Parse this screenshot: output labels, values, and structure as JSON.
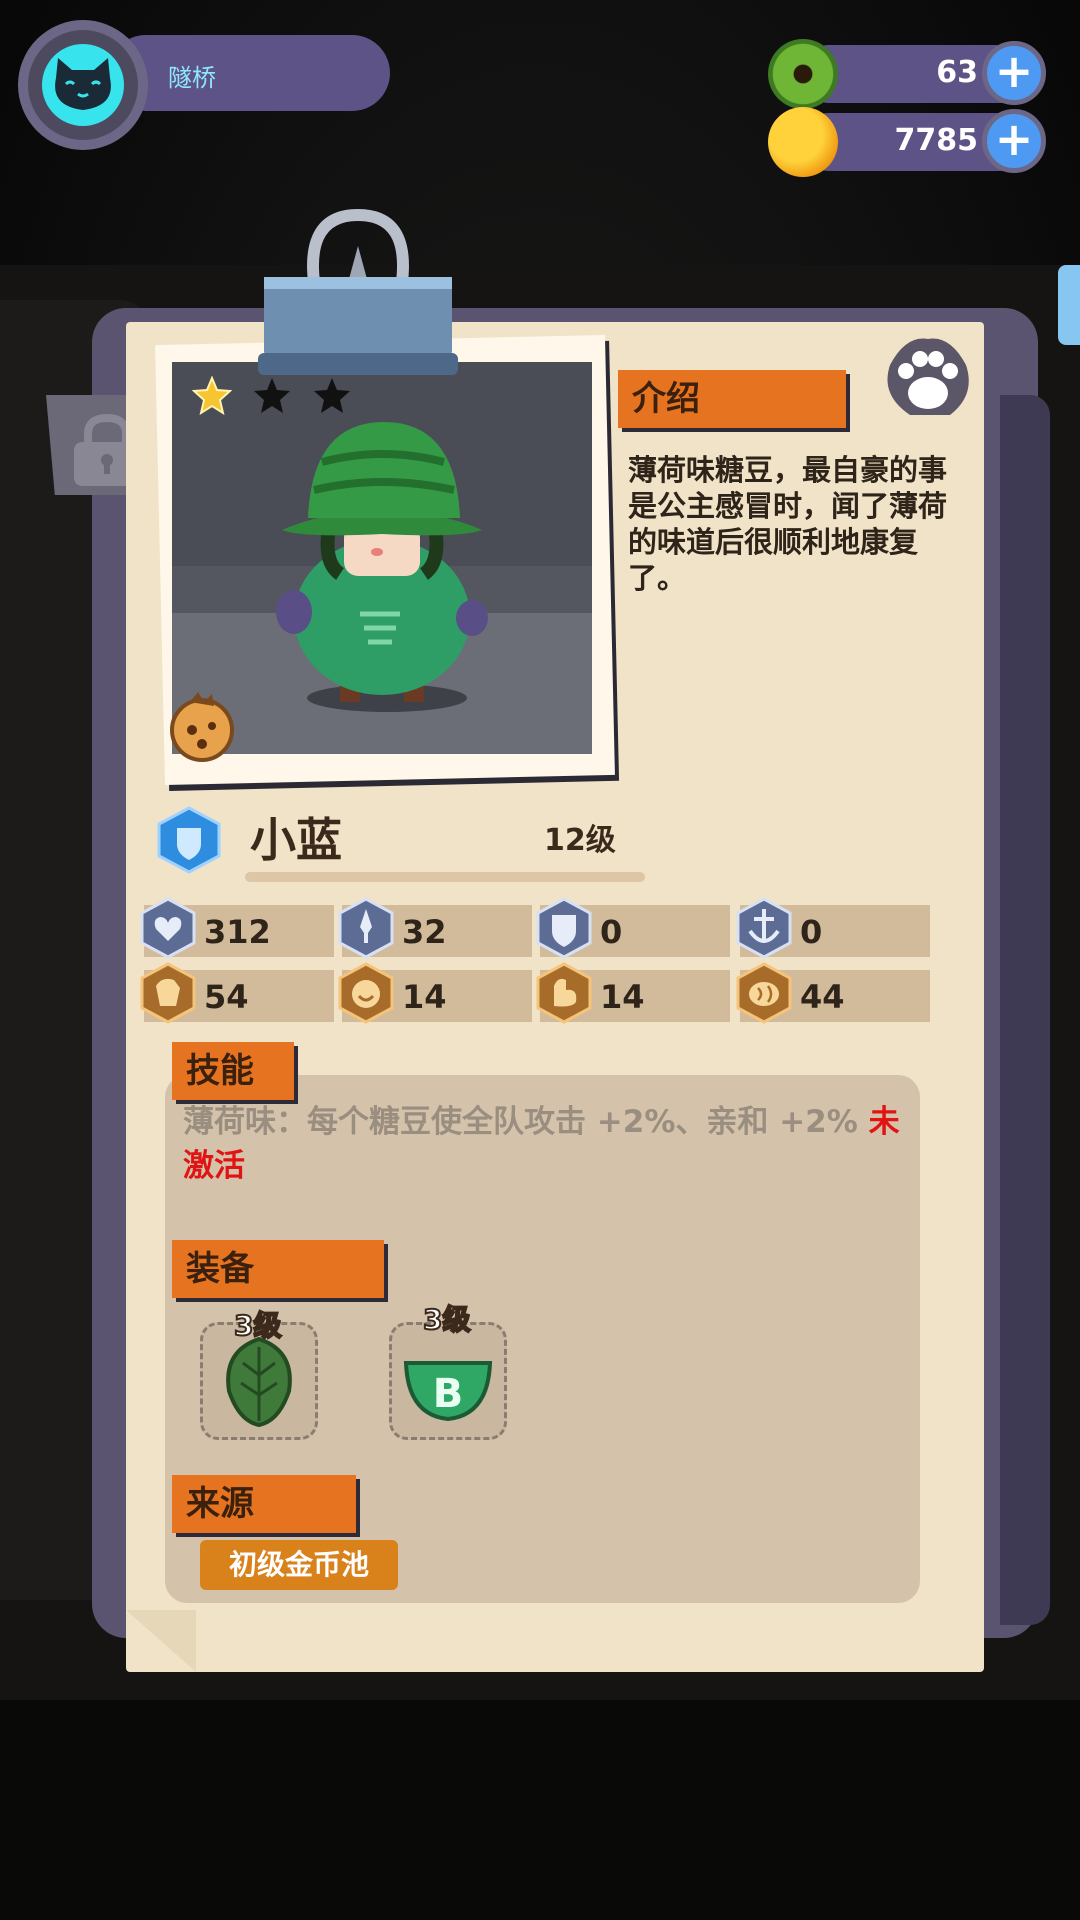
{
  "player": {
    "name": "隧桥"
  },
  "resources": [
    {
      "icon": "green-donut-icon",
      "value": "63"
    },
    {
      "icon": "gold-planet-icon",
      "value": "7785"
    }
  ],
  "character": {
    "stars_filled": 1,
    "stars_total": 3,
    "name": "小蓝",
    "level": "12级"
  },
  "intro": {
    "heading": "介绍",
    "text": "薄荷味糖豆，最自豪的事是公主感冒时，闻了薄荷的味道后很顺利地康复了。"
  },
  "stats": [
    {
      "icon": "heart-shield-icon",
      "value": "312"
    },
    {
      "icon": "sword-icon",
      "value": "32"
    },
    {
      "icon": "shield-icon",
      "value": "0"
    },
    {
      "icon": "anchor-icon",
      "value": "0"
    },
    {
      "icon": "fist-icon",
      "value": "54"
    },
    {
      "icon": "smile-icon",
      "value": "14"
    },
    {
      "icon": "muscle-icon",
      "value": "14"
    },
    {
      "icon": "brain-icon",
      "value": "44"
    }
  ],
  "skill": {
    "heading": "技能",
    "text": "薄荷味：每个糖豆使全队攻击 +2%、亲和 +2%",
    "status": "未激活"
  },
  "equipment": {
    "heading": "装备",
    "items": [
      {
        "icon": "mint-leaf-icon",
        "level": "3级"
      },
      {
        "icon": "green-bowl-b-icon",
        "level": "3级"
      }
    ]
  },
  "source": {
    "heading": "来源",
    "button": "初级金币池"
  },
  "colors": {
    "accent": "#e5731f",
    "panel": "#5e5386",
    "paper": "#f1e3c8",
    "inactive": "#e11414"
  }
}
